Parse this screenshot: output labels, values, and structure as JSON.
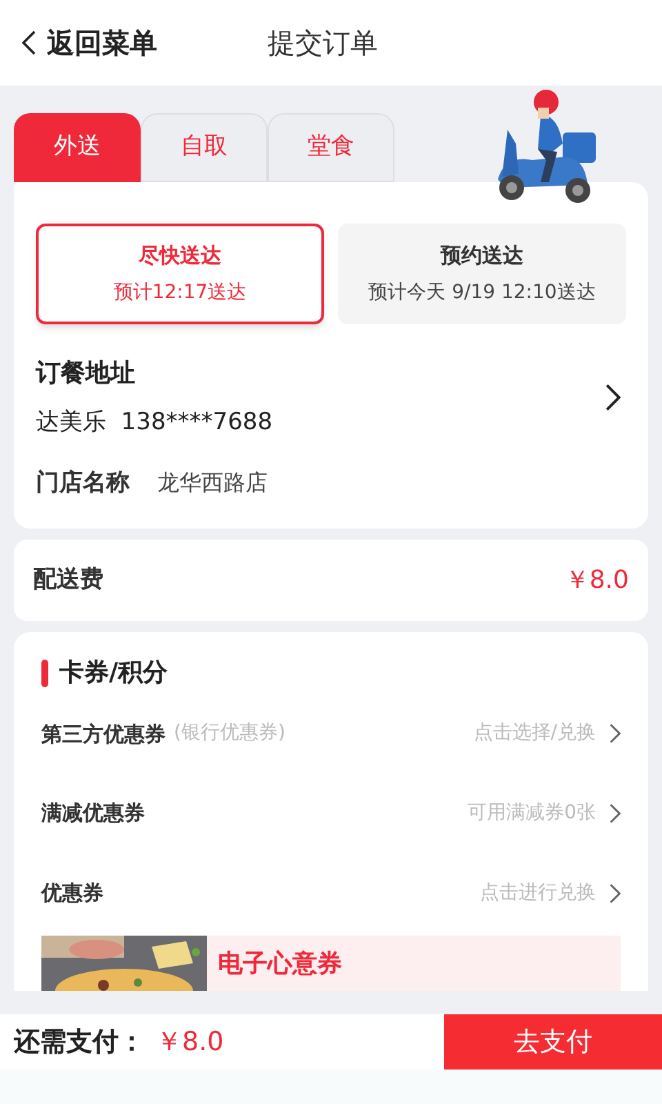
{
  "header": {
    "back_label": "返回菜单",
    "title": "提交订单"
  },
  "order_type_tabs": [
    {
      "label": "外送",
      "selected": true
    },
    {
      "label": "自取",
      "selected": false
    },
    {
      "label": "堂食",
      "selected": false
    }
  ],
  "delivery_options": [
    {
      "title": "尽快送达",
      "subtitle": "预计12:17送达",
      "selected": true
    },
    {
      "title": "预约送达",
      "subtitle": "预计今天 9/19 12:10送达",
      "selected": false
    }
  ],
  "address": {
    "label": "订餐地址",
    "contact": "达美乐  138****7688"
  },
  "store": {
    "label": "门店名称",
    "value": "龙华西路店"
  },
  "delivery_fee": {
    "label": "配送费",
    "amount": "￥8.0"
  },
  "coupons": {
    "title": "卡券/积分",
    "rows": [
      {
        "label": "第三方优惠券",
        "note": "(银行优惠券)",
        "action": "点击选择/兑换"
      },
      {
        "label": "满减优惠券",
        "action": "可用满减券0张"
      },
      {
        "label": "优惠券",
        "action": "点击进行兑换"
      }
    ],
    "gift_card": {
      "kind": "picture",
      "title": "电子心意券"
    }
  },
  "footer": {
    "label": "还需支付：",
    "amount": "￥8.0",
    "pay_button": "去支付"
  }
}
